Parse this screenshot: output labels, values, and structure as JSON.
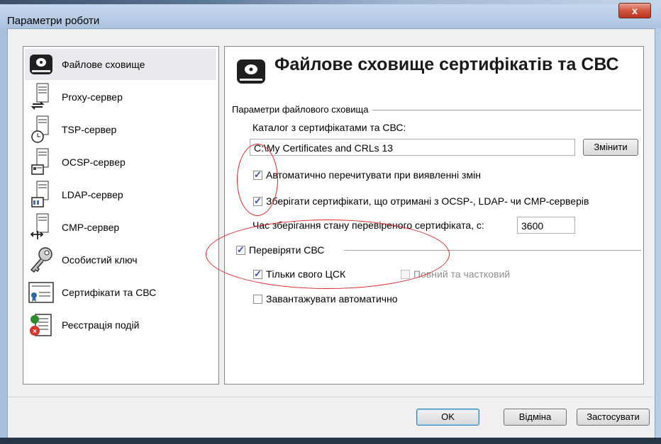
{
  "window": {
    "title": "Параметри роботи",
    "close_glyph": "x"
  },
  "nav": {
    "items": [
      {
        "label": "Файлове сховище",
        "icon": "hard-drive-icon",
        "selected": true
      },
      {
        "label": "Proxy-сервер",
        "icon": "proxy-server-icon"
      },
      {
        "label": "TSP-сервер",
        "icon": "tsp-server-icon"
      },
      {
        "label": "OCSP-сервер",
        "icon": "ocsp-server-icon"
      },
      {
        "label": "LDAP-сервер",
        "icon": "ldap-server-icon"
      },
      {
        "label": "CMP-сервер",
        "icon": "cmp-server-icon"
      },
      {
        "label": "Особистий ключ",
        "icon": "key-icon"
      },
      {
        "label": "Сертифікати та СВС",
        "icon": "certificate-icon"
      },
      {
        "label": "Реєстрація подій",
        "icon": "event-log-icon"
      }
    ]
  },
  "panel": {
    "title": "Файлове сховище сертифікатів та СВС",
    "storage_group": "Параметри файлового сховища",
    "directory_label": "Каталог з сертифікатами та СВС:",
    "directory_value": "C:\\My Certificates and CRLs 13",
    "change_button": "Змінити",
    "auto_reread_label": "Автоматично перечитувати при виявленні змін",
    "auto_reread_checked": true,
    "save_certs_label": "Зберігати сертифікати, що отримані з OCSP-, LDAP- чи CMP-серверів",
    "save_certs_checked": true,
    "cache_time_label": "Час зберігання стану перевіреного сертифіката, с:",
    "cache_time_value": "3600",
    "check_crl_label": "Перевіряти СВС",
    "check_crl_checked": true,
    "own_ca_only_label": "Тільки свого ЦСК",
    "own_ca_only_checked": true,
    "full_partial_label": "Повний та частковий",
    "full_partial_checked": false,
    "auto_download_label": "Завантажувати автоматично",
    "auto_download_checked": false
  },
  "footer": {
    "ok": "OK",
    "cancel": "Відміна",
    "apply": "Застосувати"
  },
  "colors": {
    "annotation": "#d9242b",
    "checkmark": "#3a4fa0",
    "accent": "#3c7fb1"
  }
}
